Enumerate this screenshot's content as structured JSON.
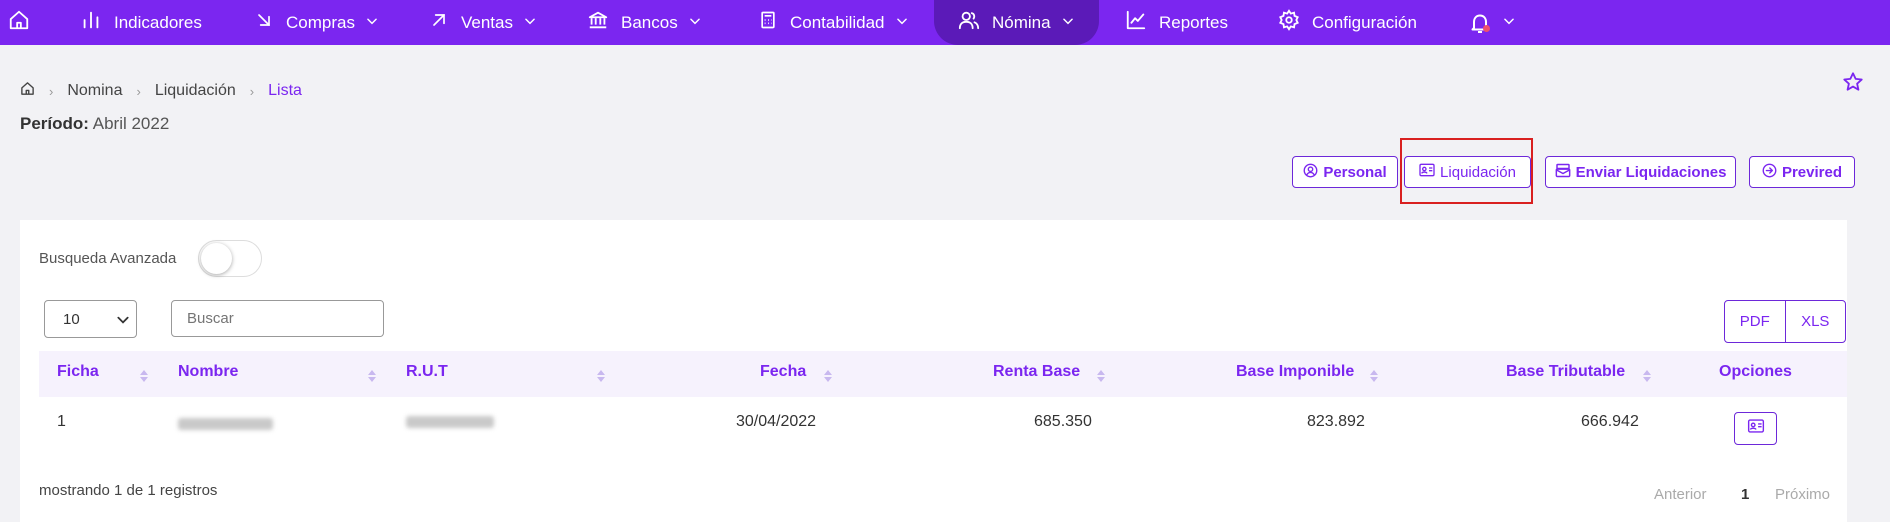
{
  "nav": {
    "items": [
      {
        "label": "Indicadores",
        "icon": "chart-bars-icon"
      },
      {
        "label": "Compras",
        "icon": "arrow-down-right-icon"
      },
      {
        "label": "Ventas",
        "icon": "arrow-up-right-icon"
      },
      {
        "label": "Bancos",
        "icon": "bank-icon"
      },
      {
        "label": "Contabilidad",
        "icon": "calculator-icon"
      },
      {
        "label": "Nómina",
        "icon": "users-icon"
      },
      {
        "label": "Reportes",
        "icon": "line-chart-icon"
      },
      {
        "label": "Configuración",
        "icon": "gear-icon"
      }
    ],
    "active": "Nómina",
    "accent": "#7b26f0",
    "active_bg": "#5b1ab8",
    "notification_dot_color": "#f0506e"
  },
  "breadcrumb": [
    "Nomina",
    "Liquidación",
    "Lista"
  ],
  "period": {
    "label": "Período:",
    "value": "Abril 2022"
  },
  "actions": {
    "personal": "Personal",
    "liquidacion": "Liquidación",
    "enviar": "Enviar Liquidaciones",
    "previred": "Previred",
    "highlight_color": "#d92020"
  },
  "filters": {
    "advanced_label": "Busqueda Avanzada",
    "advanced_on": false,
    "page_size": "10",
    "search_placeholder": "Buscar"
  },
  "export": {
    "pdf": "PDF",
    "xls": "XLS"
  },
  "table": {
    "headers": [
      "Ficha",
      "Nombre",
      "R.U.T",
      "Fecha",
      "Renta Base",
      "Base Imponible",
      "Base Tributable",
      "Opciones"
    ],
    "rows": [
      {
        "ficha": "1",
        "nombre": "",
        "rut": "",
        "fecha": "30/04/2022",
        "renta_base": "685.350",
        "base_imponible": "823.892",
        "base_tributable": "666.942"
      }
    ]
  },
  "footer": {
    "showing": "mostrando 1 de 1 registros",
    "prev": "Anterior",
    "page": "1",
    "next": "Próximo"
  }
}
